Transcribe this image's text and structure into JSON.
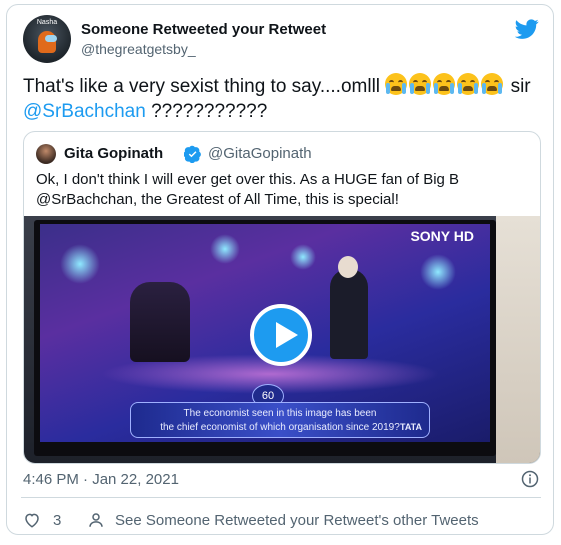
{
  "header": {
    "avatar_tag": "Nasha",
    "display_name": "Someone Retweeted your Retweet",
    "handle": "@thegreatgetsby_"
  },
  "tweet": {
    "text_part1": "That's like a very sexist thing to say....omlll",
    "text_part2": " sir",
    "mention": "@SrBachchan",
    "text_part3": " ???????????",
    "emoji_count": 5
  },
  "quote": {
    "name": "Gita Gopinath",
    "handle": "@GitaGopinath",
    "text": "Ok, I don't think I will ever get over this. As a HUGE fan of Big B @SrBachchan, the Greatest of All Time, this is special!",
    "media": {
      "channel": "SONY HD",
      "timer": "60",
      "question_line1": "The economist seen in this image has been",
      "question_line2": "the chief economist of which organisation since 2019?",
      "brand": "TATA"
    }
  },
  "footer": {
    "timestamp": "4:46 PM · Jan 22, 2021",
    "like_count": "3",
    "other_tweets": "See Someone Retweeted your Retweet's other Tweets"
  },
  "colors": {
    "accent": "#1d9bf0",
    "text": "#0f1419",
    "muted": "#536471",
    "border": "#cfd9de"
  }
}
